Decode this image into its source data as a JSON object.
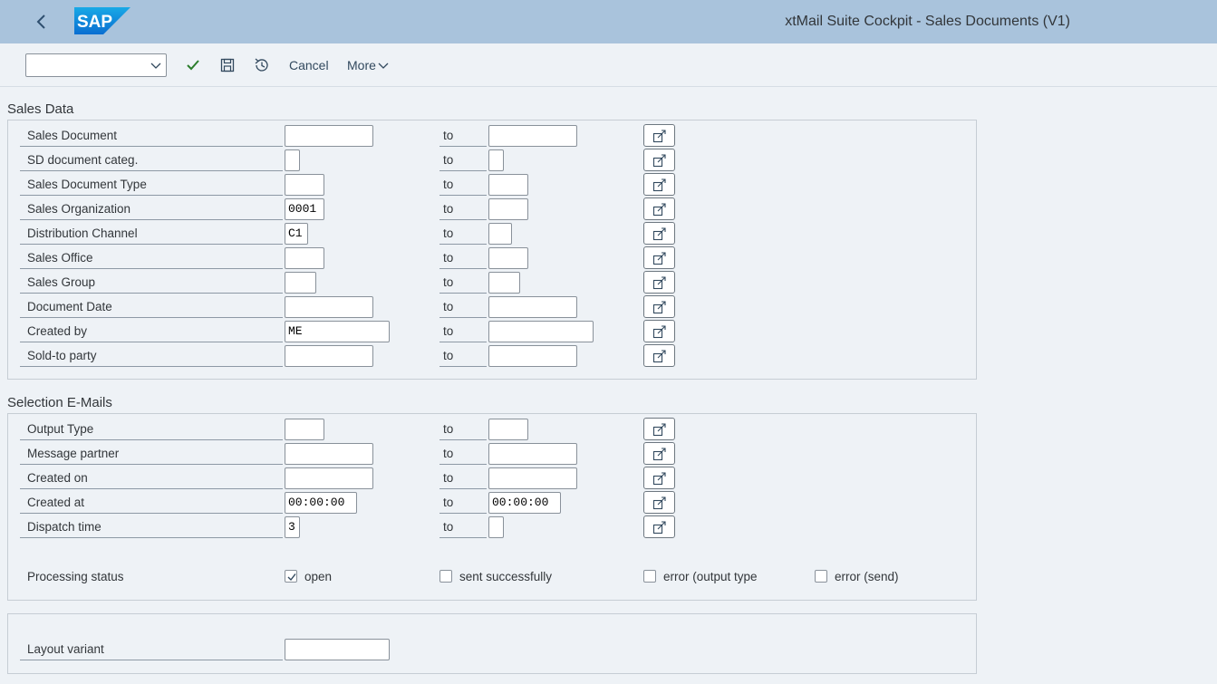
{
  "shell": {
    "title": "xtMail Suite Cockpit - Sales Documents (V1)",
    "logo_text": "SAP",
    "back_icon": "chevron-left-icon",
    "color": "#a9c3dc"
  },
  "toolbar": {
    "variant_value": "",
    "cancel_label": "Cancel",
    "more_label": "More",
    "icons": [
      "checkmark-icon",
      "save-icon",
      "history-icon"
    ]
  },
  "sales_data": {
    "title": "Sales Data",
    "to_label": "to",
    "rows": [
      {
        "label": "Sales Document",
        "from": "",
        "to": ""
      },
      {
        "label": "SD document categ.",
        "from": "",
        "to": ""
      },
      {
        "label": "Sales Document Type",
        "from": "",
        "to": ""
      },
      {
        "label": "Sales Organization",
        "from": "0001",
        "to": ""
      },
      {
        "label": "Distribution Channel",
        "from": "C1",
        "to": ""
      },
      {
        "label": "Sales Office",
        "from": "",
        "to": ""
      },
      {
        "label": "Sales Group",
        "from": "",
        "to": ""
      },
      {
        "label": "Document Date",
        "from": "",
        "to": ""
      },
      {
        "label": "Created by",
        "from": "ME",
        "to": ""
      },
      {
        "label": "Sold-to party",
        "from": "",
        "to": ""
      }
    ]
  },
  "selection_emails": {
    "title": "Selection E-Mails",
    "to_label": "to",
    "rows": [
      {
        "label": "Output Type",
        "from": "",
        "to": ""
      },
      {
        "label": "Message partner",
        "from": "",
        "to": ""
      },
      {
        "label": "Created on",
        "from": "",
        "to": ""
      },
      {
        "label": "Created at",
        "from": "00:00:00",
        "to": "00:00:00"
      },
      {
        "label": "Dispatch time",
        "from": "3",
        "to": ""
      }
    ],
    "processing_status": {
      "label": "Processing status",
      "options": [
        {
          "label": "open",
          "checked": true
        },
        {
          "label": "sent successfully",
          "checked": false
        },
        {
          "label": "error (output type",
          "checked": false
        },
        {
          "label": "error (send)",
          "checked": false
        }
      ]
    }
  },
  "layout": {
    "label": "Layout variant",
    "value": ""
  }
}
